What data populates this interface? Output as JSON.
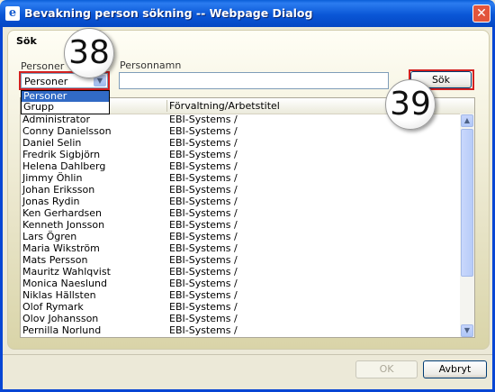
{
  "window": {
    "title": "Bevakning person sökning -- Webpage Dialog",
    "close_glyph": "✕",
    "app_icon": "ie-icon"
  },
  "section": {
    "label": "Sök"
  },
  "filter": {
    "type_label": "Personer",
    "type_selected": "Personer",
    "type_options": [
      "Personer",
      "Grupp"
    ],
    "name_label": "Personnamn",
    "name_value": "",
    "search_button": "Sök"
  },
  "table": {
    "columns": [
      "",
      "Förvaltning/Arbetstitel"
    ],
    "rows": [
      {
        "name": "Administrator",
        "org": "EBI-Systems /"
      },
      {
        "name": "Conny Danielsson",
        "org": "EBI-Systems /"
      },
      {
        "name": "Daniel Selin",
        "org": "EBI-Systems /"
      },
      {
        "name": "Fredrik Sigbjörn",
        "org": "EBI-Systems /"
      },
      {
        "name": "Helena Dahlberg",
        "org": "EBI-Systems /"
      },
      {
        "name": "Jimmy Öhlin",
        "org": "EBI-Systems /"
      },
      {
        "name": "Johan Eriksson",
        "org": "EBI-Systems /"
      },
      {
        "name": "Jonas Rydin",
        "org": "EBI-Systems /"
      },
      {
        "name": "Ken Gerhardsen",
        "org": "EBI-Systems /"
      },
      {
        "name": "Kenneth Jonsson",
        "org": "EBI-Systems /"
      },
      {
        "name": "Lars Ögren",
        "org": "EBI-Systems /"
      },
      {
        "name": "Maria Wikström",
        "org": "EBI-Systems /"
      },
      {
        "name": "Mats Persson",
        "org": "EBI-Systems /"
      },
      {
        "name": "Mauritz Wahlqvist",
        "org": "EBI-Systems /"
      },
      {
        "name": "Monica Naeslund",
        "org": "EBI-Systems /"
      },
      {
        "name": "Niklas Hällsten",
        "org": "EBI-Systems /"
      },
      {
        "name": "Olof Rymark",
        "org": "EBI-Systems /"
      },
      {
        "name": "Olov Johansson",
        "org": "EBI-Systems /"
      },
      {
        "name": "Pernilla Norlund",
        "org": "EBI-Systems /"
      }
    ]
  },
  "callouts": {
    "a": "38",
    "b": "39"
  },
  "footer": {
    "ok": "OK",
    "cancel": "Avbryt"
  },
  "colors": {
    "titlebar": "#0a56d6",
    "highlight": "#d32020",
    "selection": "#316ac5"
  }
}
